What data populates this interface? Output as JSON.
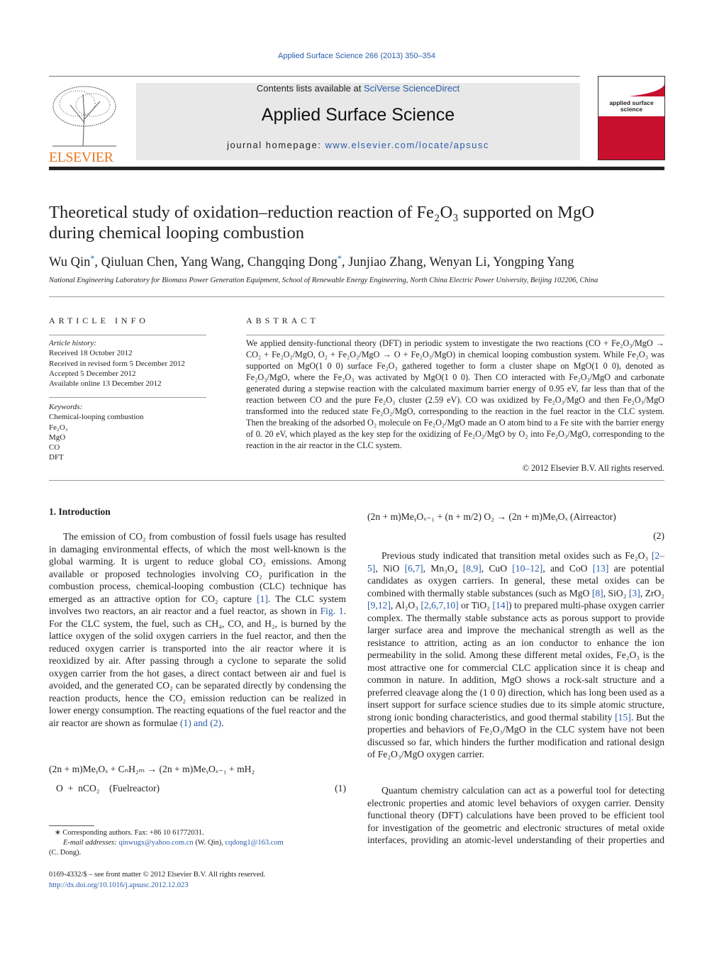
{
  "citation_line": "Applied Surface Science 266 (2013) 350–354",
  "header": {
    "publisher_logo_text": "ELSEVIER",
    "contents_prefix": "Contents lists available at ",
    "contents_link": "SciVerse ScienceDirect",
    "journal_title": "Applied Surface Science",
    "homepage_prefix": "journal homepage: ",
    "homepage_link": "www.elsevier.com/locate/apsusc",
    "cover_text": "applied surface science",
    "cover_color": "#c8102e"
  },
  "article": {
    "title_line1": "Theoretical study of oxidation–reduction reaction of Fe₂O₃ supported on MgO",
    "title_line2": "during chemical looping combustion",
    "authors": [
      {
        "name": "Wu Qin",
        "mark": "*"
      },
      {
        "name": "Qiuluan Chen"
      },
      {
        "name": "Yang Wang"
      },
      {
        "name": "Changqing Dong",
        "mark": "*"
      },
      {
        "name": "Junjiao Zhang"
      },
      {
        "name": "Wenyan Li"
      },
      {
        "name": "Yongping Yang"
      }
    ],
    "affiliation": "National Engineering Laboratory for Biomass Power Generation Equipment, School of Renewable Energy Engineering, North China Electric Power University, Beijing 102206, China"
  },
  "article_info": {
    "heading": "ARTICLE INFO",
    "history_label": "Article history:",
    "history": [
      "Received 18 October 2012",
      "Received in revised form 5 December 2012",
      "Accepted 5 December 2012",
      "Available online 13 December 2012"
    ],
    "keywords_label": "Keywords:",
    "keywords": [
      "Chemical-looping combustion",
      "Fe₂O₃",
      "MgO",
      "CO",
      "DFT"
    ]
  },
  "abstract": {
    "heading": "ABSTRACT",
    "text": "We applied density-functional theory (DFT) in periodic system to investigate the two reactions (CO + Fe₂O₃/MgO → CO₂ + Fe₂O₂/MgO, O₂ + Fe₂O₂/MgO → O + Fe₂O₃/MgO) in chemical looping combustion system. While Fe₂O₃ was supported on MgO(1 0 0) surface Fe₂O₃ gathered together to form a cluster shape on MgO(1 0 0), denoted as Fe₂O₃/MgO, where the Fe₂O₃ was activated by MgO(1 0 0). Then CO interacted with Fe₂O₃/MgO and carbonate generated during a stepwise reaction with the calculated maximum barrier energy of 0.95 eV, far less than that of the reaction between CO and the pure Fe₂O₃ cluster (2.59 eV). CO was oxidized by Fe₂O₃/MgO and then Fe₂O₃/MgO transformed into the reduced state Fe₂O₂/MgO, corresponding to the reaction in the fuel reactor in the CLC system. Then the breaking of the adsorbed O₂ molecule on Fe₂O₂/MgO made an O atom bind to a Fe site with the barrier energy of 0. 20 eV, which played as the key step for the oxidizing of Fe₂O₂/MgO by O₂ into Fe₂O₃/MgO, corresponding to the reaction in the air reactor in the CLC system.",
    "copyright": "© 2012 Elsevier B.V. All rights reserved."
  },
  "intro": {
    "heading": "1.  Introduction",
    "para1": [
      "The emission of CO₂ from combustion of fossil fuels usage has resulted in damaging environmental effects, of which the most well-known is the global warming. It is urgent to reduce global CO₂ emissions. Among available or proposed technologies involving CO₂ purification in the combustion process, chemical-looping combustion (CLC) technique has emerged as an attractive option for CO₂ capture ",
      {
        "link": "[1]"
      },
      ". The CLC system involves two reactors, an air reactor and a fuel reactor, as shown in ",
      {
        "link": "Fig. 1"
      },
      ". For the CLC system, the fuel, such as CH₄, CO, and H₂, is burned by the lattice oxygen of the solid oxygen carriers in the fuel reactor, and then the reduced oxygen carrier is transported into the air reactor where it is reoxidized by air. After passing through a cyclone to separate the solid oxygen carrier from the hot gases, a direct contact between air and fuel is avoided, and the generated CO₂ can be separated directly by condensing the reaction products, hence the CO₂ emission reduction can be realized in lower energy consumption. The reacting equations of the fuel reactor and the air reactor are shown as formulae ",
      {
        "link": "(1) and (2)"
      },
      "."
    ],
    "eq1_line1": "(2n + m)MeᵧOₓ + CₙH₂ₘ →  (2n + m)MeᵧOₓ₋₁ + mH₂",
    "eq1_line2": "O  +  nCO₂    (Fuelreactor)",
    "eq1_number": "(1)",
    "eq2": "(2n + m)MeᵧOₓ₋₁ + (n + m/2) O₂ → (2n + m)MeᵧOₓ (Airreactor)",
    "eq2_number": "(2)",
    "para2": [
      "Previous study indicated that transition metal oxides such as Fe₂O₃ ",
      {
        "link": "[2–5]"
      },
      ", NiO ",
      {
        "link": "[6,7]"
      },
      ", Mn₃O₄ ",
      {
        "link": "[8,9]"
      },
      ", CuO ",
      {
        "link": "[10–12]"
      },
      ", and CoO ",
      {
        "link": "[13]"
      },
      " are potential candidates as oxygen carriers. In general, these metal oxides can be combined with thermally stable substances (such as MgO ",
      {
        "link": "[8]"
      },
      ", SiO₂ ",
      {
        "link": "[3]"
      },
      ", ZrO₂ ",
      {
        "link": "[9,12]"
      },
      ", Al₂O₃ ",
      {
        "link": "[2,6,7,10]"
      },
      " or TiO₂ ",
      {
        "link": "[14]"
      },
      ") to prepared multi-phase oxygen carrier complex. The thermally stable substance acts as porous support to provide larger surface area and improve the mechanical strength as well as the resistance to attrition, acting as an ion conductor to enhance the ion permeability in the solid. Among these different metal oxides, Fe₂O₃ is the most attractive one for commercial CLC application since it is cheap and common in nature. In addition, MgO shows a rock-salt structure and a preferred cleavage along the (1 0 0) direction, which has long been used as a insert support for surface science studies due to its simple atomic structure, strong ionic bonding characteristics, and good thermal stability ",
      {
        "link": "[15]"
      },
      ". But the properties and behaviors of Fe₂O₃/MgO in the CLC system have not been discussed so far, which hinders the further modification and rational design of Fe₂O₃/MgO oxygen carrier."
    ],
    "para3": [
      "Quantum chemistry calculation can act as a powerful tool for detecting electronic properties and atomic level behaviors of oxygen carrier. Density functional theory (DFT) calculations have been proved to be efficient tool for investigation of the geometric and electronic structures of metal oxide interfaces, providing an atomic-level understanding of their properties and"
    ]
  },
  "footnote": {
    "corresponding": "∗  Corresponding authors. Fax: +86 10 61772031.",
    "email_label": "E-mail addresses: ",
    "email1": "qinwugx@yahoo.com.cn",
    "email1_who": " (W. Qin), ",
    "email2": "cqdong1@163.com",
    "email2_who": "(C. Dong)."
  },
  "bottom": {
    "issn": "0169-4332/$ – see front matter © 2012 Elsevier B.V. All rights reserved.",
    "doi": "http://dx.doi.org/10.1016/j.apsusc.2012.12.023"
  }
}
